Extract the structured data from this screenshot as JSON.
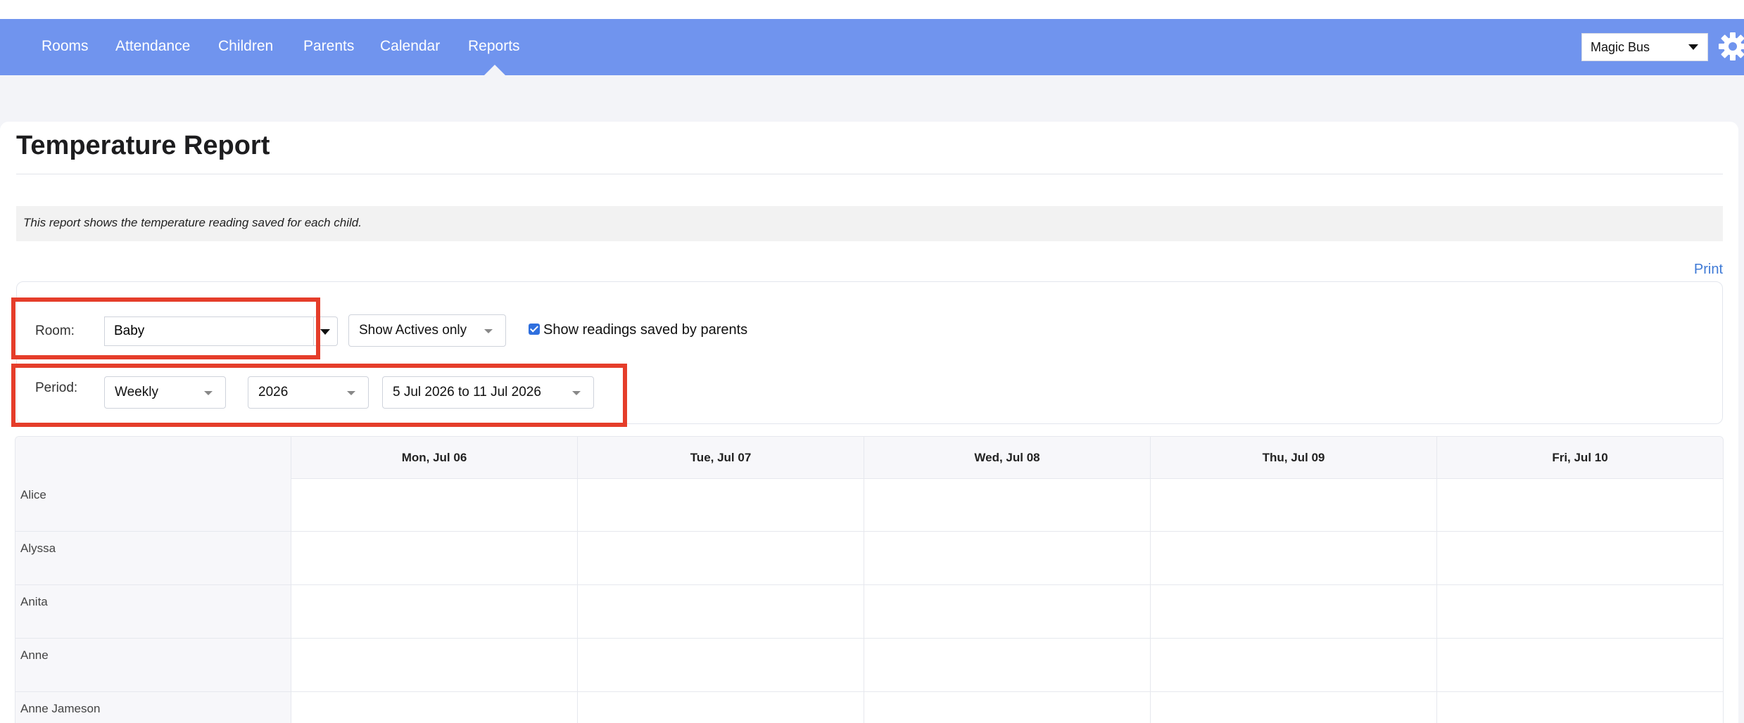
{
  "nav": {
    "items": [
      {
        "label": "Rooms"
      },
      {
        "label": "Attendance"
      },
      {
        "label": "Children"
      },
      {
        "label": "Parents"
      },
      {
        "label": "Calendar"
      },
      {
        "label": "Reports",
        "active": true
      }
    ],
    "org_selector": {
      "value": "Magic Bus"
    },
    "settings_icon": "gear-icon",
    "accent_color": "#7094ee"
  },
  "page": {
    "title": "Temperature Report",
    "description": "This report shows the temperature reading saved for each child.",
    "print_label": "Print"
  },
  "filters": {
    "room_label": "Room:",
    "room_value": "Baby",
    "status_value": "Show Actives only",
    "show_parent_readings_label": "Show readings saved by parents",
    "show_parent_readings_checked": true,
    "period_label": "Period:",
    "period_type": "Weekly",
    "year": "2026",
    "range": "5 Jul 2026 to 11 Jul 2026"
  },
  "table": {
    "columns": [
      "Mon, Jul 06",
      "Tue, Jul 07",
      "Wed, Jul 08",
      "Thu, Jul 09",
      "Fri, Jul 10"
    ],
    "rows": [
      "Alice",
      "Alyssa",
      "Anita",
      "Anne",
      "Anne Jameson"
    ]
  },
  "highlight_color": "#e53d2a"
}
